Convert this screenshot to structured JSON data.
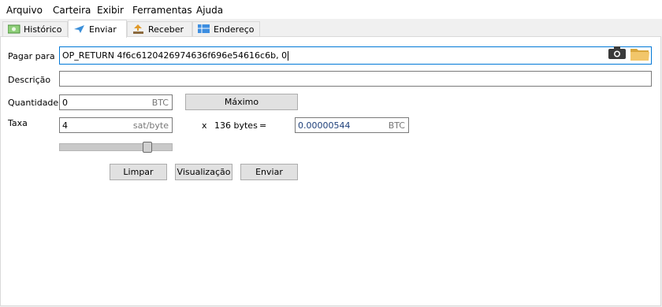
{
  "menu": [
    "Arquivo",
    "Carteira",
    "Exibir",
    "Ferramentas",
    "Ajuda"
  ],
  "tabs": [
    {
      "label": "Histórico",
      "icon": "history-icon"
    },
    {
      "label": "Enviar",
      "icon": "send-icon"
    },
    {
      "label": "Receber",
      "icon": "receive-icon"
    },
    {
      "label": "Endereço",
      "icon": "address-icon"
    }
  ],
  "form": {
    "pay_to_label": "Pagar para",
    "pay_to_value": "OP_RETURN 4f6c6120426974636f696e54616c6b, 0",
    "description_label": "Descrição",
    "description_value": "",
    "amount_label": "Quantidade",
    "amount_value": "0",
    "amount_unit": "BTC",
    "max_button": "Máximo",
    "fee_label": "Taxa",
    "fee_value": "4",
    "fee_unit": "sat/byte",
    "times": "x",
    "size": "136 bytes",
    "equals": "=",
    "total_value": "0.00000544",
    "total_unit": "BTC",
    "fee_slider_fraction": 0.8
  },
  "buttons": {
    "clear": "Limpar",
    "preview": "Visualização",
    "send": "Enviar"
  }
}
